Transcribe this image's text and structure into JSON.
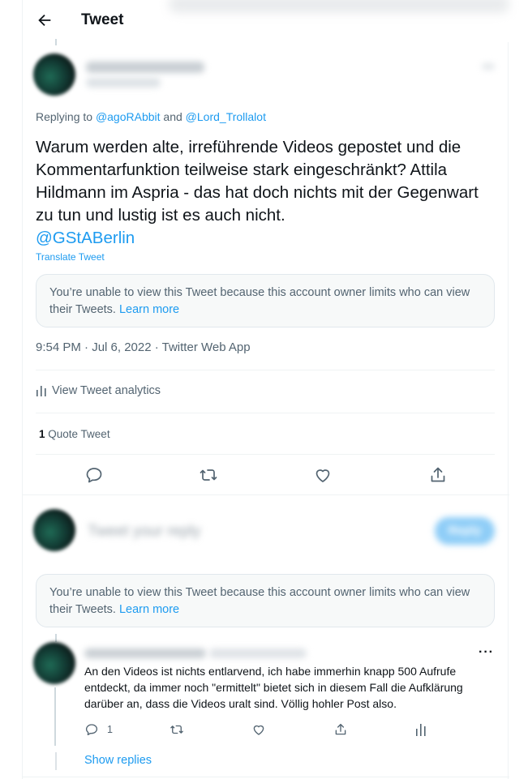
{
  "header": {
    "title": "Tweet",
    "back_icon": "back-arrow-icon"
  },
  "tweet": {
    "replying_prefix": "Replying to ",
    "replying_user1": "@agoRAbbit",
    "replying_and": " and ",
    "replying_user2": "@Lord_Trollalot",
    "text": "Warum werden alte, irreführende Videos gepostet und die Kommentarfunktion teilweise stark eingeschränkt? Attila Hildmann im Aspria - das hat doch nichts mit der Gegenwart zu tun und lustig ist es auch nicht.",
    "mention": "@GStABerlin",
    "translate_label": "Translate Tweet",
    "notice_text": "You’re unable to view this Tweet because this account owner limits who can view their Tweets. ",
    "notice_link": "Learn more",
    "meta": "9:54 PM · Jul 6, 2022 · Twitter Web App",
    "analytics_label": "View Tweet analytics",
    "quote_count": "1",
    "quote_label": " Quote Tweet"
  },
  "notice2": {
    "text": "You’re unable to view this Tweet because this account owner limits who can view their Tweets. ",
    "link": "Learn more"
  },
  "reply": {
    "text": "An den Videos ist nichts entlarvend, ich habe immerhin knapp 500 Aufrufe entdeckt, da immer noch \"ermittelt\" bietet sich in diesem Fall die Aufklärung darüber an, dass die Videos uralt sind. Völlig hohler Post also.",
    "more": "···",
    "reply_count": "1",
    "show_replies": "Show replies"
  },
  "colors": {
    "accent": "#1d9bf0",
    "muted": "#536471",
    "text": "#0f1419",
    "notice_bg": "#f7f9f9"
  }
}
